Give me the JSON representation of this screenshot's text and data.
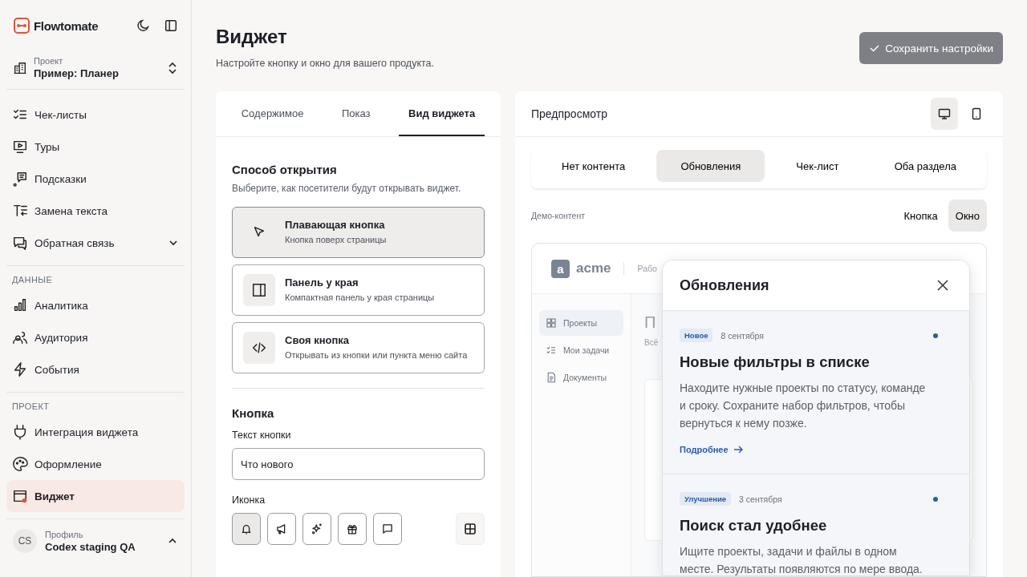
{
  "sidebar": {
    "brand": "Flowtomate",
    "project": {
      "label": "Проект",
      "value": "Пример: Планер"
    },
    "groups": [
      {
        "items": [
          {
            "label": "Чек-листы",
            "selected": false
          },
          {
            "label": "Туры",
            "selected": false
          },
          {
            "label": "Подсказки",
            "selected": false
          },
          {
            "label": "Замена текста",
            "selected": false
          },
          {
            "label": "Обратная связь",
            "selected": false,
            "expanded": false
          }
        ]
      },
      {
        "heading": "ДАННЫЕ",
        "items": [
          {
            "label": "Аналитика",
            "selected": false
          },
          {
            "label": "Аудитория",
            "selected": false
          },
          {
            "label": "События",
            "selected": false
          }
        ]
      },
      {
        "heading": "ПРОЕКТ",
        "items": [
          {
            "label": "Интеграция виджета",
            "selected": false
          },
          {
            "label": "Оформление",
            "selected": false
          },
          {
            "label": "Виджет",
            "selected": true
          }
        ]
      }
    ],
    "profile": {
      "initials": "CS",
      "label": "Профиль",
      "name": "Codex staging QA"
    }
  },
  "header": {
    "title": "Виджет",
    "subtitle": "Настройте кнопку и окно для вашего продукта.",
    "save_button": {
      "label": "Сохранить настройки",
      "disabled": true
    }
  },
  "settings": {
    "tabs": [
      {
        "label": "Содержимое",
        "selected": false
      },
      {
        "label": "Показ",
        "selected": false
      },
      {
        "label": "Вид виджета",
        "selected": true
      }
    ],
    "open_method": {
      "title": "Способ открытия",
      "description": "Выберите, как посетители будут открывать виджет.",
      "options": [
        {
          "title": "Плавающая кнопка",
          "description": "Кнопка поверх страницы",
          "selected": true
        },
        {
          "title": "Панель у края",
          "description": "Компактная панель у края страницы",
          "selected": false
        },
        {
          "title": "Своя кнопка",
          "description": "Открывать из кнопки или пункта меню сайта",
          "selected": false
        }
      ]
    },
    "button": {
      "title": "Кнопка",
      "text_label": "Текст кнопки",
      "text_value": "Что нового",
      "icon_label": "Иконка",
      "icons": [
        {
          "selected": true
        },
        {
          "selected": false
        },
        {
          "selected": false
        },
        {
          "selected": false
        },
        {
          "selected": false
        }
      ]
    }
  },
  "preview": {
    "title": "Предпросмотр",
    "devices": [
      {
        "selected": true
      },
      {
        "selected": false
      }
    ],
    "modes": [
      {
        "label": "Нет контента",
        "selected": false
      },
      {
        "label": "Обновления",
        "selected": true
      },
      {
        "label": "Чек-лист",
        "selected": false
      },
      {
        "label": "Оба раздела",
        "selected": false
      }
    ],
    "demo_label": "Демо-контент",
    "views": [
      {
        "label": "Кнопка",
        "selected": false
      },
      {
        "label": "Окно",
        "selected": true
      }
    ],
    "demo": {
      "logo_letter": "a",
      "logo": "acme",
      "breadcrumb": "Рабо",
      "nav": [
        {
          "label": "Проекты",
          "selected": true
        },
        {
          "label": "Мои задачи",
          "selected": false
        },
        {
          "label": "Документы",
          "selected": false
        }
      ],
      "heading": "П",
      "subheading": "Всё"
    },
    "popup": {
      "title": "Обновления",
      "entries": [
        {
          "tag": "Новое",
          "date": "8 сентября",
          "unread": true,
          "title": "Новые фильтры в списке",
          "body": "Находите нужные проекты по статусу, команде и сроку. Сохраните набор фильтров, чтобы вернуться к нему позже.",
          "link": "Подробнее"
        },
        {
          "tag": "Улучшение",
          "date": "3 сентября",
          "unread": true,
          "title": "Поиск стал удобнее",
          "body": "Ищите проекты, задачи и файлы в одном месте. Результаты появляются по мере ввода."
        }
      ]
    }
  }
}
